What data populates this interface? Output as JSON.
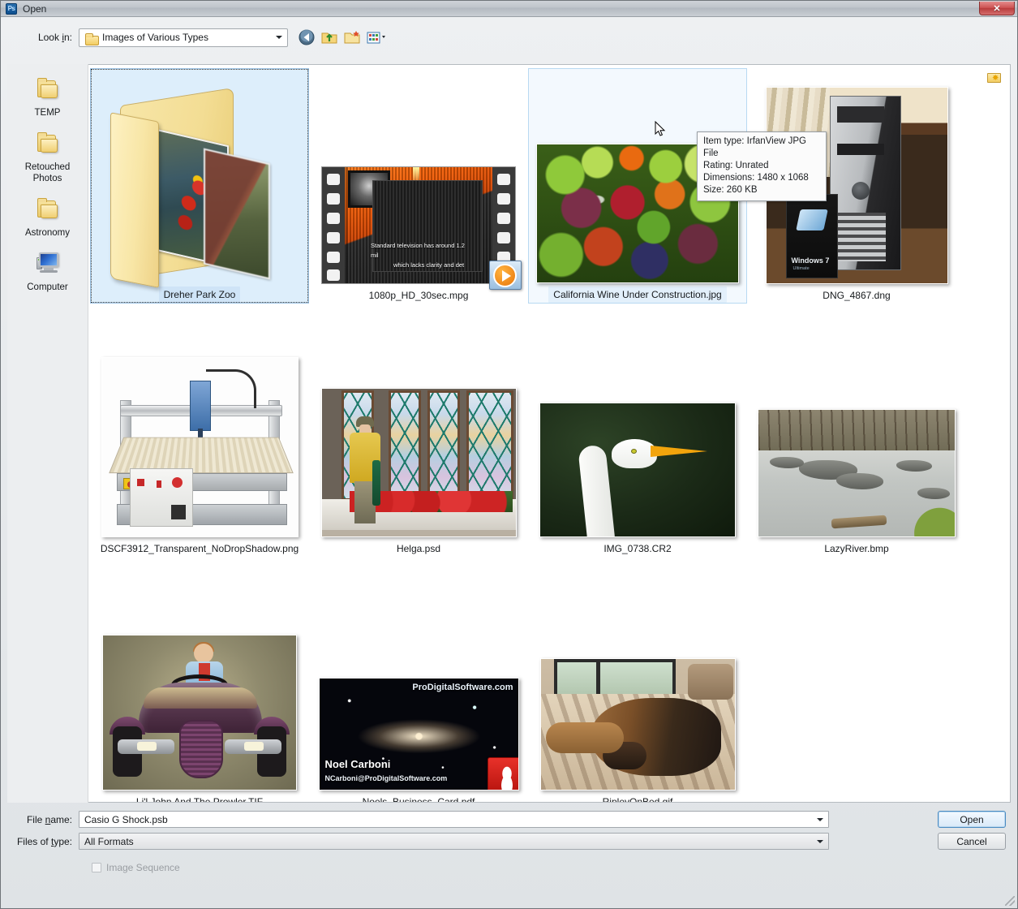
{
  "window": {
    "title": "Open",
    "app_icon": "photoshop-icon",
    "close_label": "✕"
  },
  "toolbar": {
    "lookin_label": "Look in:",
    "lookin_value": "Images of Various Types",
    "buttons": [
      {
        "name": "back-button",
        "icon": "back-arrow-icon"
      },
      {
        "name": "up-one-level-button",
        "icon": "up-folder-icon"
      },
      {
        "name": "create-new-folder-button",
        "icon": "new-folder-icon"
      },
      {
        "name": "views-button",
        "icon": "views-grid-icon"
      }
    ]
  },
  "sidebar": {
    "items": [
      {
        "label": "TEMP",
        "icon": "folder-icon"
      },
      {
        "label": "Retouched Photos",
        "icon": "folder-icon"
      },
      {
        "label": "Astronomy",
        "icon": "folder-icon"
      },
      {
        "label": "Computer",
        "icon": "computer-icon"
      }
    ]
  },
  "fileview": {
    "favorites_icon": "favorites-folder-icon",
    "files": [
      {
        "label": "Dreher Park Zoo",
        "state": "selected",
        "kind": "folder"
      },
      {
        "label": "1080p_HD_30sec.mpg",
        "state": "normal",
        "kind": "video"
      },
      {
        "label": "California Wine Under Construction.jpg",
        "state": "hover",
        "kind": "image"
      },
      {
        "label": "DNG_4867.dng",
        "state": "normal",
        "kind": "image"
      },
      {
        "label": "DSCF3912_Transparent_NoDropShadow.png",
        "state": "normal",
        "kind": "image"
      },
      {
        "label": "Helga.psd",
        "state": "normal",
        "kind": "image"
      },
      {
        "label": "IMG_0738.CR2",
        "state": "normal",
        "kind": "image"
      },
      {
        "label": "LazyRiver.bmp",
        "state": "normal",
        "kind": "image"
      },
      {
        "label": "Li'l John And The Prowler.TIF",
        "state": "normal",
        "kind": "image"
      },
      {
        "label": "Noels_Business_Card.pdf",
        "state": "normal",
        "kind": "pdf"
      },
      {
        "label": "RipleyOnBed.gif",
        "state": "normal",
        "kind": "image"
      }
    ],
    "mpg_caption_line1": "Standard television has around 1.2 mil",
    "mpg_caption_line2": "which lacks clarity and det",
    "card_site": "ProDigitalSoftware.com",
    "card_name": "Noel Carboni",
    "card_email": "NCarboni@ProDigitalSoftware.com",
    "dng_win_title": "Windows 7",
    "dng_win_sub": "Ultimate"
  },
  "tooltip": {
    "item_type": "Item type: IrfanView JPG File",
    "rating": "Rating: Unrated",
    "dimensions": "Dimensions: 1480 x 1068",
    "size": "Size: 260 KB"
  },
  "bottom": {
    "filename_label": "File name:",
    "filename_value": "Casio G Shock.psb",
    "filetype_label": "Files of type:",
    "filetype_value": "All Formats",
    "open_button": "Open",
    "cancel_button": "Cancel",
    "sequence_label": "Image Sequence"
  }
}
